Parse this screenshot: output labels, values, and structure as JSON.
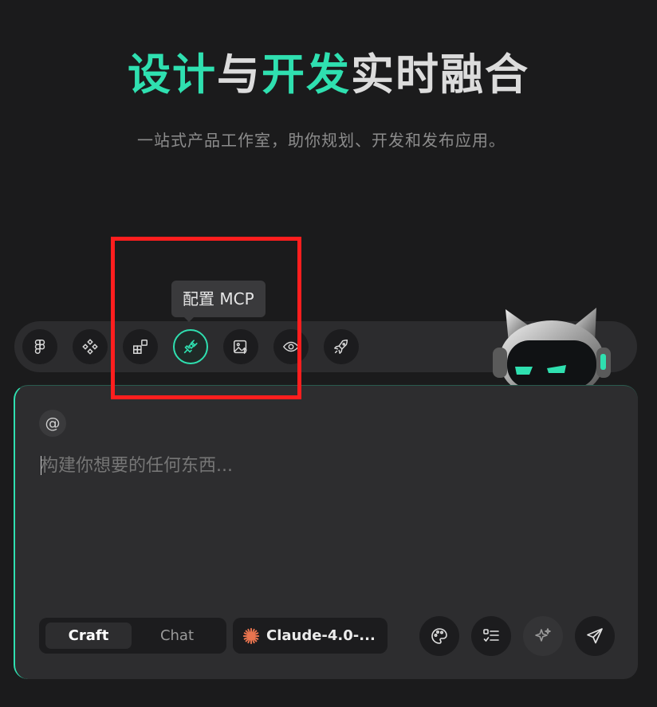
{
  "hero": {
    "title_part1": "设计",
    "title_part2": "与",
    "title_part3": "开发",
    "title_part4": "实时融合",
    "subtitle": "一站式产品工作室，助你规划、开发和发布应用。"
  },
  "toolbar": {
    "tooltip": "配置 MCP",
    "tools": [
      {
        "icon": "figma-icon"
      },
      {
        "icon": "components-icon"
      },
      {
        "icon": "blocks-icon"
      },
      {
        "icon": "plug-icon"
      },
      {
        "icon": "image-upload-icon"
      },
      {
        "icon": "eye-icon"
      },
      {
        "icon": "rocket-icon"
      }
    ]
  },
  "composer": {
    "mention_symbol": "@",
    "placeholder": "构建你想要的任何东西...",
    "value": "",
    "mode_active": "Craft",
    "mode_inactive": "Chat",
    "model": "Claude-4.0-..."
  },
  "colors": {
    "accent": "#2fe0b0",
    "background": "#1b1b1c",
    "highlight": "#ff1e1e",
    "claude_orange": "#e8744f"
  }
}
